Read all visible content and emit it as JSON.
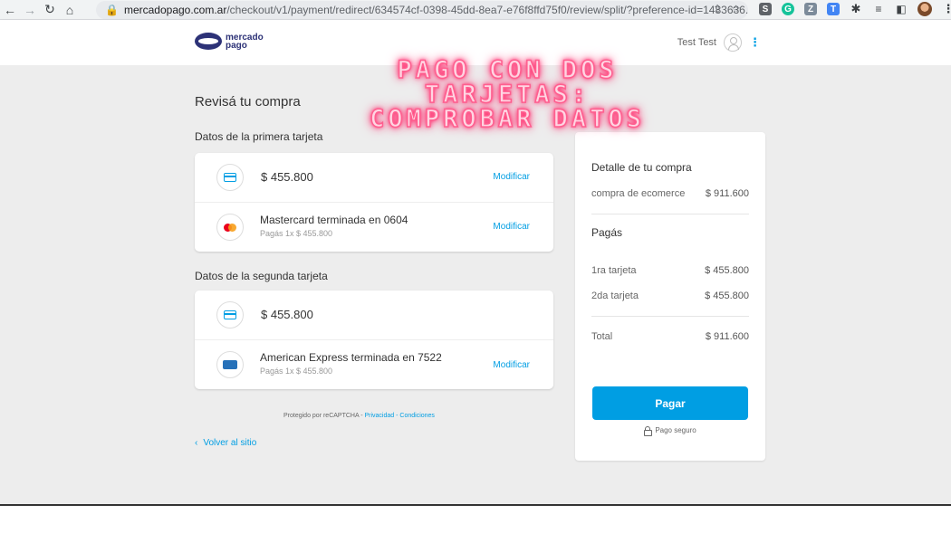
{
  "browser": {
    "url_host": "mercadopago.com.ar",
    "url_path": "/checkout/v1/payment/redirect/634574cf-0398-45dd-8ea7-e76f8ffd75f0/review/split/?preference-id=1483636..."
  },
  "header": {
    "logo_line1": "mercado",
    "logo_line2": "pago",
    "user_name": "Test Test",
    "menu_glyph": "⋮"
  },
  "overlay": {
    "line1": "PAGO CON DOS",
    "line2": "TARJETAS:",
    "line3": "COMPROBAR DATOS"
  },
  "page": {
    "title": "Revisá tu compra",
    "first_card_label": "Datos de la primera tarjeta",
    "second_card_label": "Datos de la segunda tarjeta"
  },
  "first_card": {
    "amount": "$ 455.800",
    "modify": "Modificar",
    "card_title": "Mastercard terminada en 0604",
    "card_sub": "Pagás 1x $ 455.800",
    "card_modify": "Modificar",
    "card_icon": "mastercard-icon"
  },
  "second_card": {
    "amount": "$ 455.800",
    "card_title": "American Express terminada en 7522",
    "card_sub": "Pagás 1x $ 455.800",
    "card_modify": "Modificar",
    "card_icon": "amex-icon"
  },
  "footer": {
    "recaptcha_prefix": "Protegido por reCAPTCHA - ",
    "privacy": "Privacidad",
    "separator": " - ",
    "conditions": "Condiciones",
    "back_link": "Volver al sitio"
  },
  "summary": {
    "title": "Detalle de tu compra",
    "item_label": "compra de ecomerce",
    "item_value": "$ 911.600",
    "pay_heading": "Pagás",
    "first_label": "1ra tarjeta",
    "first_value": "$ 455.800",
    "second_label": "2da tarjeta",
    "second_value": "$ 455.800",
    "total_label": "Total",
    "total_value": "$ 911.600",
    "pay_button": "Pagar",
    "secure": "Pago seguro"
  },
  "colors": {
    "accent": "#009ee3",
    "brand": "#2d3277",
    "overlay_glow": "#ff2a6d"
  }
}
